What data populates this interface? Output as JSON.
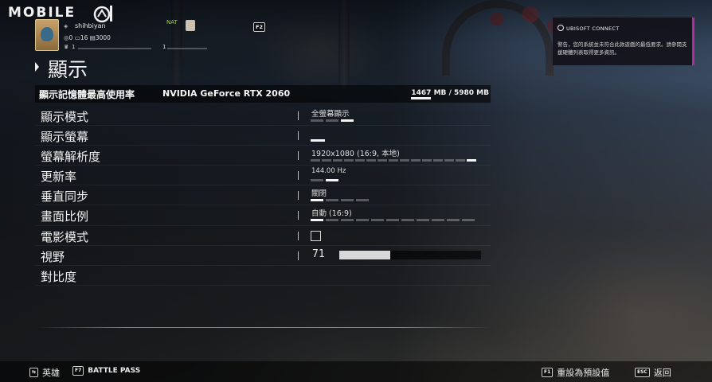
{
  "watermark": {
    "text": "MOBILE"
  },
  "player": {
    "name": "shihbiyan",
    "renown": "0",
    "level": "16",
    "credits": "3000",
    "rank_left": "1",
    "rank_right": "1",
    "nat_label": "NAT",
    "party_key": "F2"
  },
  "notification": {
    "brand": "UBISOFT CONNECT",
    "message": "警告，您的系統並未符合此款遊戲的最低要求。請參閱支援硬體列表取得更多資訊。",
    "accent_color": "#b02aa0"
  },
  "page": {
    "title": "顯示"
  },
  "vram": {
    "label": "顯示記憶體最高使用率",
    "gpu": "NVIDIA GeForce RTX 2060",
    "used": "1467",
    "used_unit": "MB",
    "separator": "/",
    "total": "5980 MB"
  },
  "settings": [
    {
      "label": "顯示模式",
      "value": "全螢幕顯示"
    },
    {
      "label": "顯示螢幕",
      "value": ""
    },
    {
      "label": "螢幕解析度",
      "value": "1920x1080 (16:9, 本地)"
    },
    {
      "label": "更新率",
      "value": "144.00 Hz"
    },
    {
      "label": "垂直同步",
      "value": "關閉"
    },
    {
      "label": "畫面比例",
      "value": "自動 (16:9)"
    },
    {
      "label": "電影模式",
      "checked": false
    },
    {
      "label": "視野",
      "value": "71",
      "fraction": 0.36
    },
    {
      "label": "對比度"
    }
  ],
  "footer": {
    "operators_key": "⇆",
    "operators_label": "英雄",
    "battlepass_key": "F7",
    "battlepass_label": "BATTLE PASS",
    "reset_key": "F1",
    "reset_label": "重設為預設值",
    "back_key": "ESC",
    "back_label": "返回"
  }
}
